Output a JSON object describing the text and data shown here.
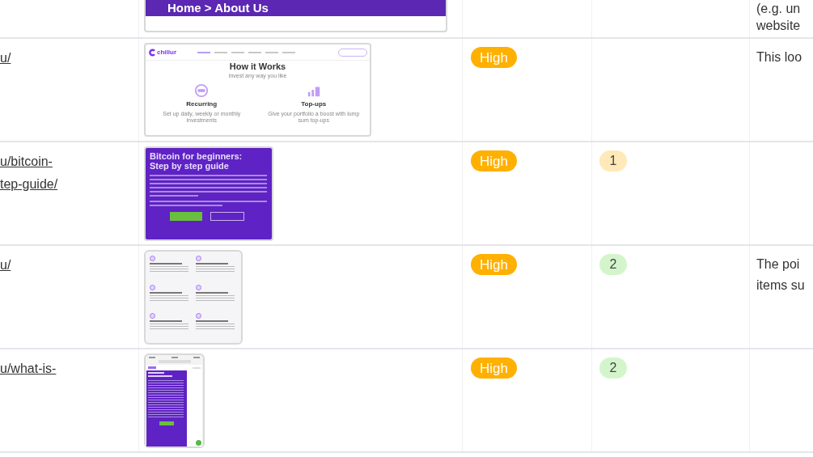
{
  "rows": [
    {
      "link_lines": [],
      "thumbnail": {
        "kind": "banner",
        "texts": [
          "Home > About Us"
        ]
      },
      "priority": null,
      "count": null,
      "note_lines": [
        "(e.g. un",
        "website"
      ]
    },
    {
      "link_lines": [
        "u/"
      ],
      "thumbnail": {
        "kind": "how_it_works",
        "texts": [
          "chillur",
          "How it Works",
          "Invest any way you like",
          "Recurring",
          "Set up daily, weekly or monthly investments",
          "Top-ups",
          "Give your portfolio a boost with lump sum top-ups"
        ]
      },
      "priority": {
        "label": "High",
        "color": "#ffb000"
      },
      "count": null,
      "note_lines": [
        "This loo"
      ]
    },
    {
      "link_lines": [
        "u/bitcoin-",
        "tep-guide/"
      ],
      "thumbnail": {
        "kind": "article",
        "texts": [
          "Bitcoin for beginners:",
          "Step by step guide"
        ]
      },
      "priority": {
        "label": "High",
        "color": "#ffb000"
      },
      "count": {
        "label": "1",
        "color": "#ffe9b8"
      },
      "note_lines": []
    },
    {
      "link_lines": [
        "u/"
      ],
      "thumbnail": {
        "kind": "features"
      },
      "priority": {
        "label": "High",
        "color": "#ffb000"
      },
      "count": {
        "label": "2",
        "color": "#d4f5cc"
      },
      "note_lines": [
        "The poi",
        "items su"
      ]
    },
    {
      "link_lines": [
        "u/what-is-"
      ],
      "thumbnail": {
        "kind": "mobile"
      },
      "priority": {
        "label": "High",
        "color": "#ffb000"
      },
      "count": {
        "label": "2",
        "color": "#d4f5cc"
      },
      "note_lines": []
    }
  ]
}
